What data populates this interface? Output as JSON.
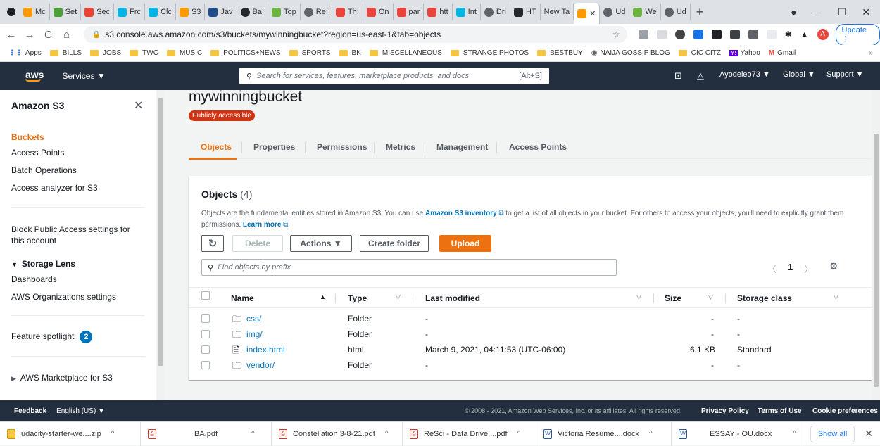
{
  "browser": {
    "tabs": [
      "Mc",
      "Set",
      "Sec",
      "Frc",
      "Clc",
      "S3",
      "Jav",
      "Ba:",
      "Top",
      "Re:",
      "Th:",
      "On",
      "par",
      "htt",
      "Int",
      "Dri",
      "HT",
      "New Ta",
      "",
      "Ud",
      "We",
      "Ud"
    ],
    "url": "s3.console.aws.amazon.com/s3/buckets/mywinningbucket?region=us-east-1&tab=objects",
    "update_label": "Update",
    "avatar_letter": "A",
    "bookmarks": [
      "Apps",
      "BILLS",
      "JOBS",
      "TWC",
      "MUSIC",
      "POLITICS+NEWS",
      "SPORTS",
      "BK",
      "MISCELLANEOUS",
      "STRANGE PHOTOS",
      "BESTBUY",
      "NAIJA GOSSIP BLOG",
      "CIC CITZ",
      "Yahoo",
      "Gmail"
    ]
  },
  "aws_header": {
    "logo": "aws",
    "services": "Services ▼",
    "search_placeholder": "Search for services, features, marketplace products, and docs",
    "search_hint": "[Alt+S]",
    "user": "Ayodeleo73 ▼",
    "region": "Global ▼",
    "support": "Support ▼"
  },
  "sidebar": {
    "title": "Amazon S3",
    "items": [
      "Buckets",
      "Access Points",
      "Batch Operations",
      "Access analyzer for S3"
    ],
    "block_public": "Block Public Access settings for this account",
    "storage_lens": "Storage Lens",
    "dashboards": "Dashboards",
    "orgs": "AWS Organizations settings",
    "feature_spotlight": "Feature spotlight",
    "feature_count": "2",
    "marketplace": "AWS Marketplace for S3"
  },
  "bucket": {
    "name": "mywinningbucket",
    "badge": "Publicly accessible",
    "tabs": [
      "Objects",
      "Properties",
      "Permissions",
      "Metrics",
      "Management",
      "Access Points"
    ]
  },
  "objects": {
    "title": "Objects",
    "count": "(4)",
    "desc_1": "Objects are the fundamental entities stored in Amazon S3. You can use",
    "desc_link": "Amazon S3 inventory",
    "desc_2": "to get a list of all objects in your bucket. For others to access your objects, you'll need to explicitly grant them permissions.",
    "learn_more": "Learn more",
    "buttons": {
      "delete": "Delete",
      "actions": "Actions ▼",
      "create_folder": "Create folder",
      "upload": "Upload"
    },
    "filter_placeholder": "Find objects by prefix",
    "page": "1",
    "columns": [
      "Name",
      "Type",
      "Last modified",
      "Size",
      "Storage class"
    ],
    "rows": [
      {
        "name": "css/",
        "type": "Folder",
        "modified": "-",
        "size": "-",
        "class": "-"
      },
      {
        "name": "img/",
        "type": "Folder",
        "modified": "-",
        "size": "-",
        "class": "-"
      },
      {
        "name": "index.html",
        "type": "html",
        "modified": "March 9, 2021, 04:11:53 (UTC-06:00)",
        "size": "6.1 KB",
        "class": "Standard"
      },
      {
        "name": "vendor/",
        "type": "Folder",
        "modified": "-",
        "size": "-",
        "class": "-"
      }
    ]
  },
  "footer": {
    "feedback": "Feedback",
    "language": "English (US) ▼",
    "copyright": "© 2008 - 2021, Amazon Web Services, Inc. or its affiliates. All rights reserved.",
    "privacy": "Privacy Policy",
    "terms": "Terms of Use",
    "cookies": "Cookie preferences"
  },
  "downloads": {
    "items": [
      "udacity-starter-we....zip",
      "BA.pdf",
      "Constellation 3-8-21.pdf",
      "ReSci - Data Drive....pdf",
      "Victoria Resume....docx",
      "ESSAY - OU.docx"
    ],
    "show_all": "Show all"
  },
  "colors": {
    "aws_dark": "#232f3e",
    "accent": "#ec7211",
    "link": "#0073bb",
    "danger": "#d13212"
  }
}
